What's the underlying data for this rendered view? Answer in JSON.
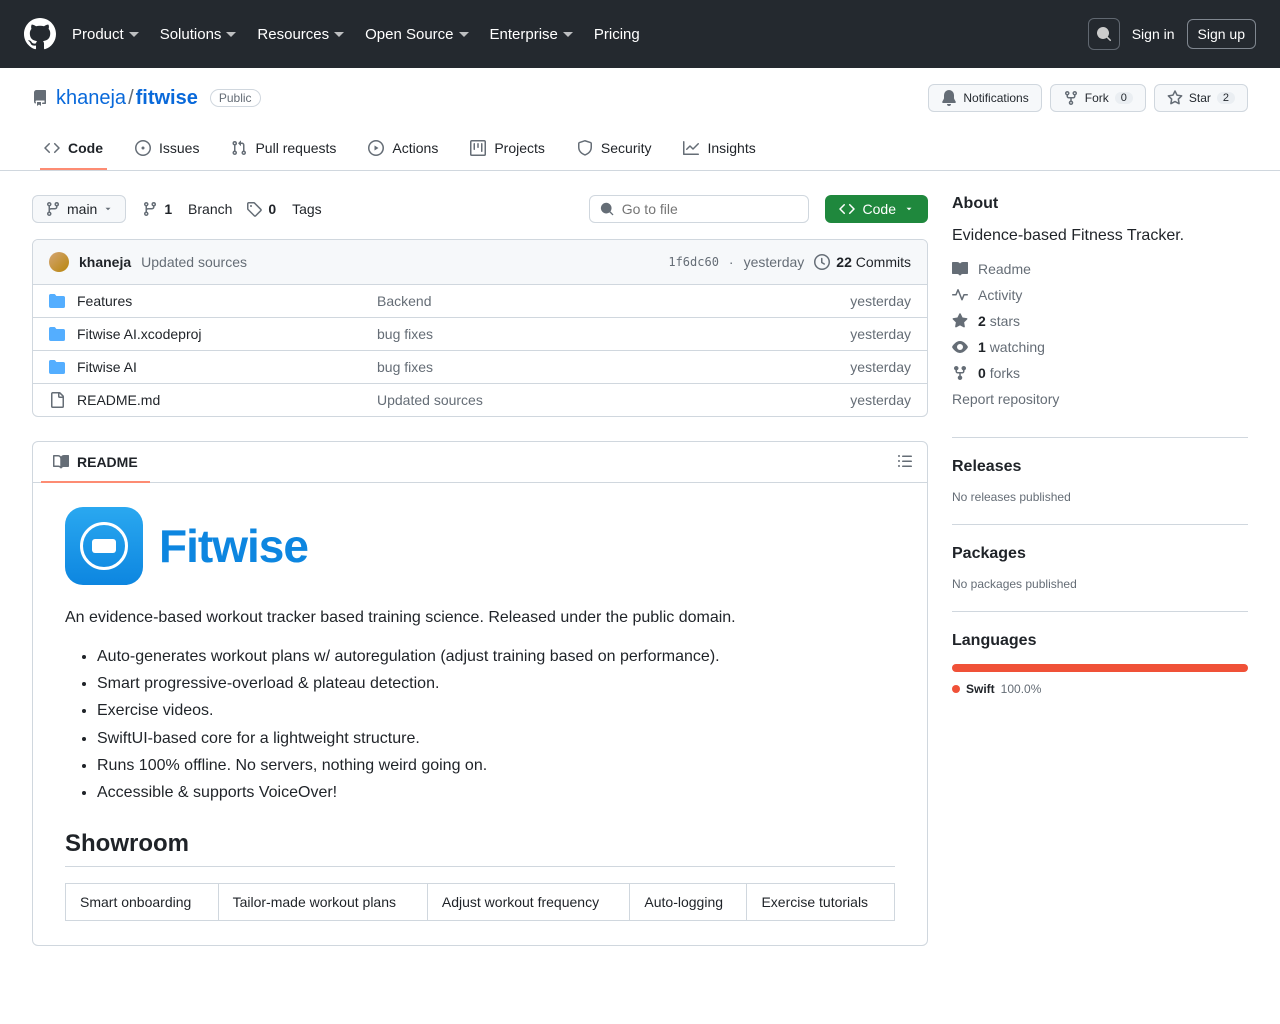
{
  "nav": {
    "items": [
      "Product",
      "Solutions",
      "Resources",
      "Open Source",
      "Enterprise"
    ],
    "pricing": "Pricing",
    "signin": "Sign in",
    "signup": "Sign up"
  },
  "repo": {
    "owner": "khaneja",
    "name": "fitwise",
    "visibility": "Public",
    "actions": {
      "notifications": "Notifications",
      "fork": "Fork",
      "fork_count": "0",
      "star": "Star",
      "star_count": "2"
    }
  },
  "tabs": {
    "code": "Code",
    "issues": "Issues",
    "prs": "Pull requests",
    "actions": "Actions",
    "projects": "Projects",
    "security": "Security",
    "insights": "Insights"
  },
  "toolbar": {
    "branch": "main",
    "branches_count": "1",
    "branches_label": "Branch",
    "tags_count": "0",
    "tags_label": "Tags",
    "search_placeholder": "Go to file",
    "code_btn": "Code"
  },
  "commit": {
    "author": "khaneja",
    "message": "Updated sources",
    "sha": "1f6dc60",
    "time": "yesterday",
    "count_num": "22",
    "count_label": "Commits"
  },
  "files": [
    {
      "type": "dir",
      "name": "Features",
      "msg": "Backend",
      "time": "yesterday"
    },
    {
      "type": "dir",
      "name": "Fitwise AI.xcodeproj",
      "msg": "bug fixes",
      "time": "yesterday"
    },
    {
      "type": "dir",
      "name": "Fitwise AI",
      "msg": "bug fixes",
      "time": "yesterday"
    },
    {
      "type": "file",
      "name": "README.md",
      "msg": "Updated sources",
      "time": "yesterday"
    }
  ],
  "readme": {
    "tab_label": "README",
    "app_name": "Fitwise",
    "intro": "An evidence-based workout tracker based training science. Released under the public domain.",
    "bullets": [
      "Auto-generates workout plans w/ autoregulation (adjust training based on performance).",
      "Smart progressive-overload & plateau detection.",
      "Exercise videos.",
      "SwiftUI-based core for a lightweight structure.",
      "Runs 100% offline. No servers, nothing weird going on.",
      "Accessible & supports VoiceOver!"
    ],
    "showroom_heading": "Showroom",
    "showroom_cells": [
      "Smart onboarding",
      "Tailor-made workout plans",
      "Adjust workout frequency",
      "Auto-logging",
      "Exercise tutorials"
    ]
  },
  "sidebar": {
    "about_heading": "About",
    "about_desc": "Evidence-based Fitness Tracker.",
    "readme_link": "Readme",
    "activity_link": "Activity",
    "stars_count": "2",
    "stars_label": "stars",
    "watching_count": "1",
    "watching_label": "watching",
    "forks_count": "0",
    "forks_label": "forks",
    "report_link": "Report repository",
    "releases_heading": "Releases",
    "releases_text": "No releases published",
    "packages_heading": "Packages",
    "packages_text": "No packages published",
    "languages_heading": "Languages",
    "lang_name": "Swift",
    "lang_pct": "100.0%"
  }
}
